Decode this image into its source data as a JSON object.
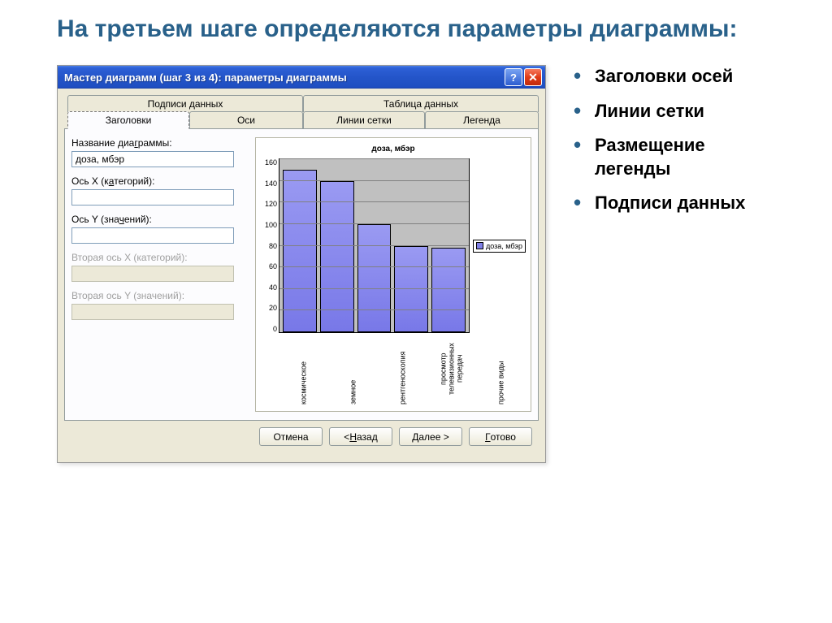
{
  "slide": {
    "title": "На третьем шаге определяются\n параметры диаграммы:"
  },
  "bullets": [
    "Заголовки осей",
    "Линии сетки",
    "Размещение легенды",
    "Подписи данных"
  ],
  "dialog": {
    "caption": "Мастер диаграмм (шаг 3 из 4): параметры диаграммы",
    "tabs_top": [
      "Подписи данных",
      "Таблица данных"
    ],
    "tabs_bottom": [
      "Заголовки",
      "Оси",
      "Линии сетки",
      "Легенда"
    ],
    "active_tab": "Заголовки",
    "form": {
      "chart_title_label": "Название диаграммы:",
      "chart_title_value": "доза, мбэр",
      "axis_x_label": "Ось X (категорий):",
      "axis_x_value": "",
      "axis_y_label": "Ось Y (значений):",
      "axis_y_value": "",
      "axis_x2_label": "Вторая ось X (категорий):",
      "axis_y2_label": "Вторая ось Y (значений):"
    },
    "buttons": {
      "cancel": "Отмена",
      "back": "< Назад",
      "next": "Далее >",
      "finish": "Готово"
    }
  },
  "chart_data": {
    "type": "bar",
    "title": "доза, мбэр",
    "categories": [
      "космическое",
      "земное",
      "рентгеноскопия",
      "просмотр телевизионных передач",
      "прочие виды"
    ],
    "values": [
      150,
      140,
      100,
      80,
      78
    ],
    "legend": "доза, мбэр",
    "ylim": [
      0,
      160
    ],
    "yticks": [
      0,
      20,
      40,
      60,
      80,
      100,
      120,
      140,
      160
    ],
    "xlabel": "",
    "ylabel": ""
  }
}
